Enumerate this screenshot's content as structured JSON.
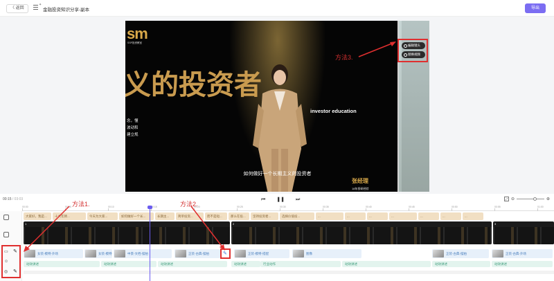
{
  "header": {
    "back_label": "〈 返回",
    "title": "金融投资知识分享-副本",
    "export_label": "导出"
  },
  "video": {
    "logo": "sm",
    "logo_sub": "SSP投资教室",
    "big_title": "义的投资者",
    "side_lines": [
      "念，懂",
      "波动和",
      "建立规"
    ],
    "investor_text": "investor education",
    "subtitle": "如何做好一个长期主义的投资者",
    "name_tag": "张经理",
    "name_sub": "18年投研经验"
  },
  "tools": {
    "crop_label": "编辑镜头",
    "replace_label": "替换视频"
  },
  "annotations": {
    "method1": "方法1.",
    "method2": "方法2.",
    "method3": "方法3."
  },
  "timeline": {
    "current": "00:15",
    "total": "/ 03:03",
    "ticks": [
      "00:00",
      "00:05",
      "00:10",
      "00:15",
      "00:20",
      "00:25",
      "00:30",
      "00:35",
      "00:40",
      "00:45",
      "00:50",
      "00:55",
      "01:00"
    ],
    "captions": [
      "大家好，我是...",
      "十六年牌...",
      "今天为大家...",
      "如何做好一个长...",
      "长期主...",
      "简单投资...",
      "而不是短...",
      "那么在投...",
      "坚持投资者...",
      "选择价值投...",
      "...",
      "...",
      "...",
      "...",
      "...",
      "...",
      "..."
    ],
    "scenes": [
      "1",
      "2",
      "3"
    ],
    "avatars": [
      "女装-模特-外场",
      "女装-模特-...",
      "中景-文档-摆拍",
      "正装-古典-摆拍",
      "正装-模特-搭配",
      "图像",
      "正装-古典-摆拍",
      "正装-古典-外场"
    ],
    "tags": [
      "动效讲述",
      "动效讲述",
      "动效讲述",
      "动效讲述",
      "动效讲述",
      "行业动作",
      "动效讲述",
      "动效讲述",
      "动效讲述"
    ]
  }
}
